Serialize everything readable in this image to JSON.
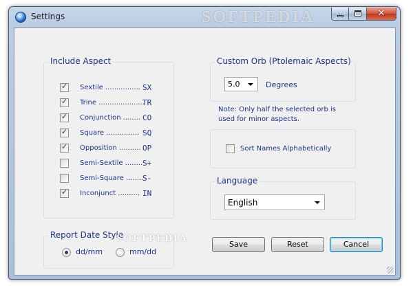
{
  "window": {
    "title": "Settings",
    "watermark": "SOFTPEDIA",
    "watermark_small": "SOFTPEDIA"
  },
  "include_aspect": {
    "title": "Include Aspect",
    "items": [
      {
        "label": "Sextile ................",
        "code": "SX",
        "checked": true
      },
      {
        "label": "Trine .....................",
        "code": "TR",
        "checked": true
      },
      {
        "label": "Conjunction ........",
        "code": "CO",
        "checked": true
      },
      {
        "label": "Square ...............",
        "code": "SQ",
        "checked": true
      },
      {
        "label": "Opposition ..........",
        "code": "OP",
        "checked": true
      },
      {
        "label": "Semi-Sextile ........",
        "code": "S+",
        "checked": false
      },
      {
        "label": "Semi-Square ........",
        "code": "S-",
        "checked": false
      },
      {
        "label": "Inconjunct ..........",
        "code": "IN",
        "checked": true
      }
    ]
  },
  "report_date": {
    "title": "Report Date Style",
    "options": [
      {
        "label": "dd/mm",
        "selected": true
      },
      {
        "label": "mm/dd",
        "selected": false
      }
    ]
  },
  "custom_orb": {
    "title": "Custom Orb  (Ptolemaic Aspects)",
    "value": "5.0",
    "unit": "Degrees",
    "note_line1": "Note: Only half the selected orb is",
    "note_line2": "used for minor aspects."
  },
  "sort": {
    "label": "Sort Names Alphabetically",
    "checked": false
  },
  "language": {
    "title": "Language",
    "value": "English"
  },
  "buttons": {
    "save": "Save",
    "reset": "Reset",
    "cancel": "Cancel"
  }
}
